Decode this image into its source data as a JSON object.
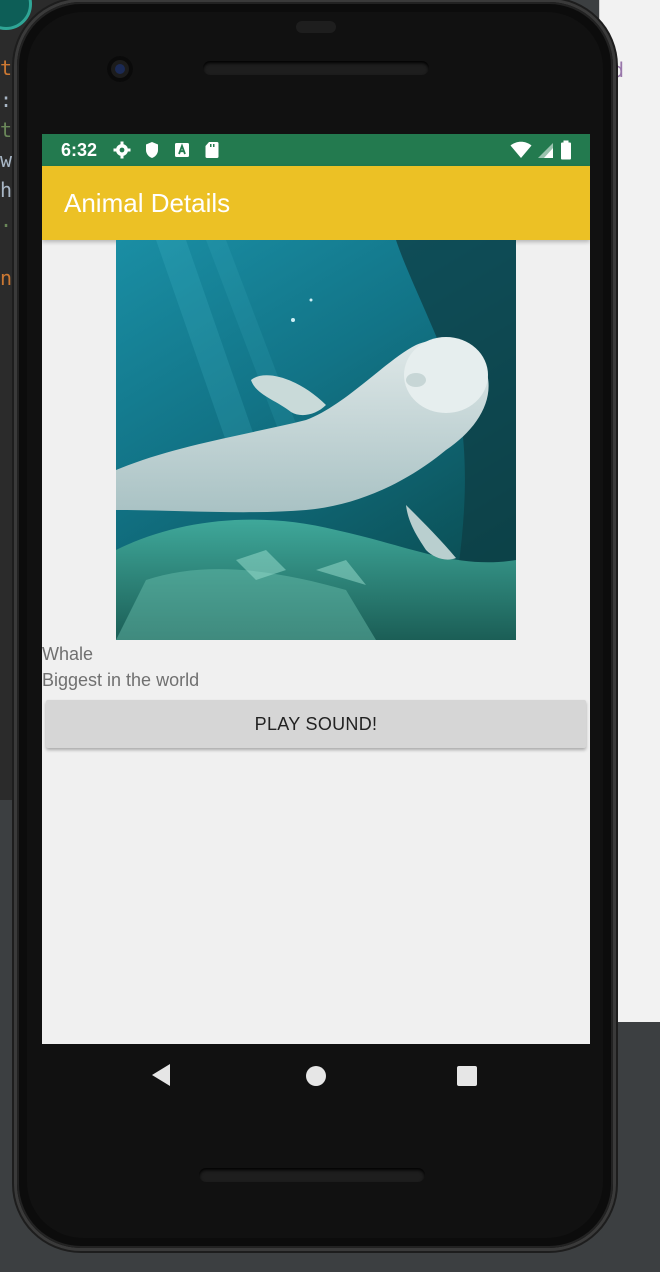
{
  "status_bar": {
    "time": "6:32",
    "left_icons": [
      "settings-icon",
      "shield-icon",
      "a-icon",
      "sdcard-icon"
    ],
    "right_icons": [
      "wifi-icon",
      "signal-icon",
      "battery-icon"
    ],
    "color": "#237a4f"
  },
  "app_bar": {
    "title": "Animal Details",
    "color": "#ecc125"
  },
  "animal": {
    "image_icon": "beluga-whale-image",
    "name": "Whale",
    "description": "Biggest in the world"
  },
  "actions": {
    "play_sound_label": "PLAY SOUND!"
  },
  "nav_bar": {
    "icons": [
      "back-icon",
      "home-icon",
      "recents-icon"
    ]
  }
}
